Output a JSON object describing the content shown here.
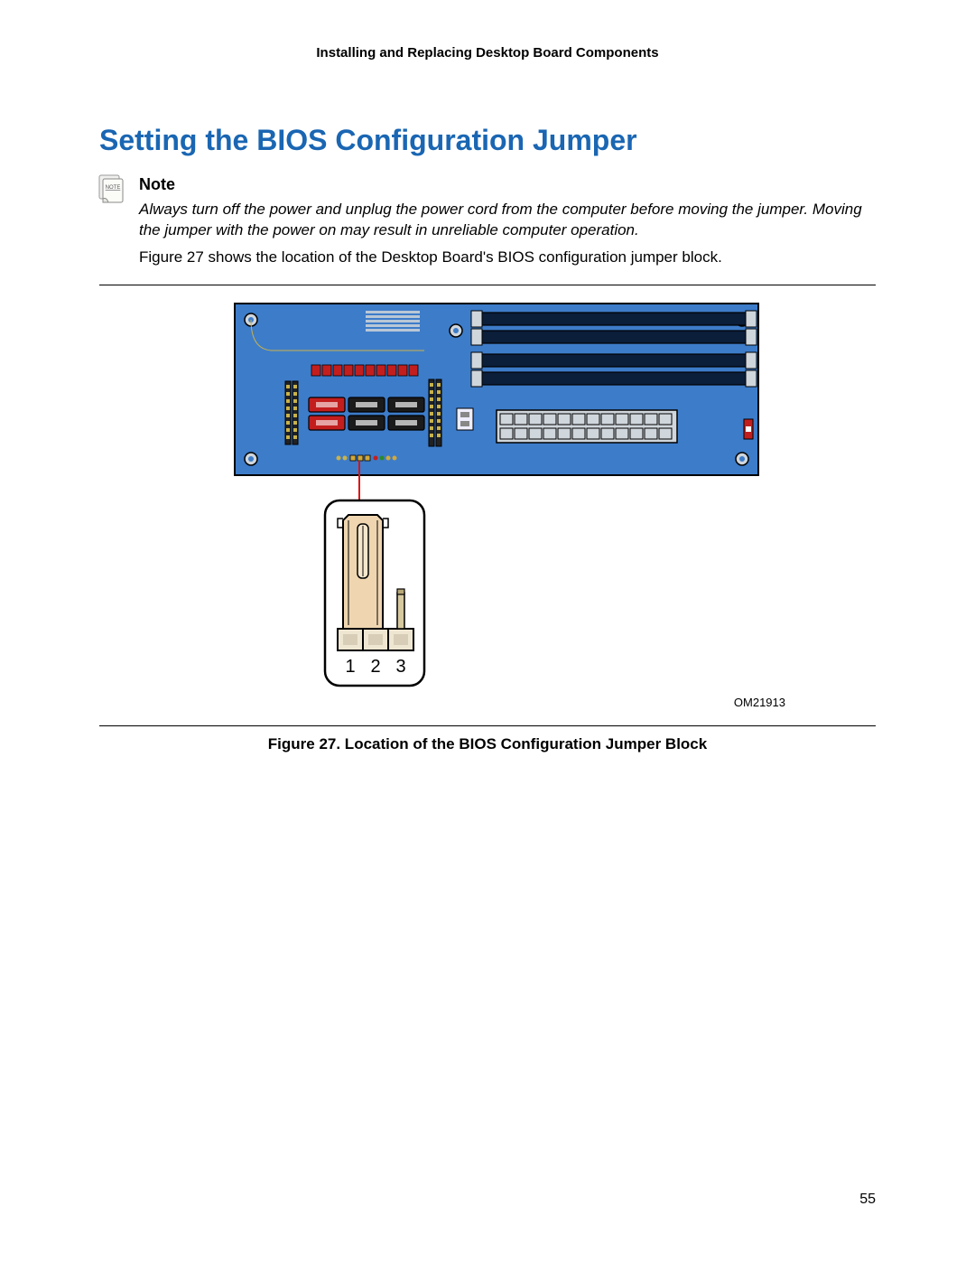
{
  "header": {
    "running": "Installing and Replacing Desktop Board Components"
  },
  "section": {
    "title": "Setting the BIOS Configuration Jumper"
  },
  "note": {
    "label": "NOTE",
    "heading": "Note",
    "body": "Always turn off the power and unplug the power cord from the computer before moving the jumper.  Moving the jumper with the power on may result in unreliable computer operation."
  },
  "paragraph": {
    "lead": "Figure 27 shows the location of the Desktop Board's BIOS configuration jumper block."
  },
  "figure": {
    "om_label": "OM21913",
    "caption": "Figure 27.  Location of the BIOS Configuration Jumper Block",
    "jumper_pins": {
      "p1": "1",
      "p2": "2",
      "p3": "3"
    }
  },
  "page": {
    "number": "55"
  }
}
